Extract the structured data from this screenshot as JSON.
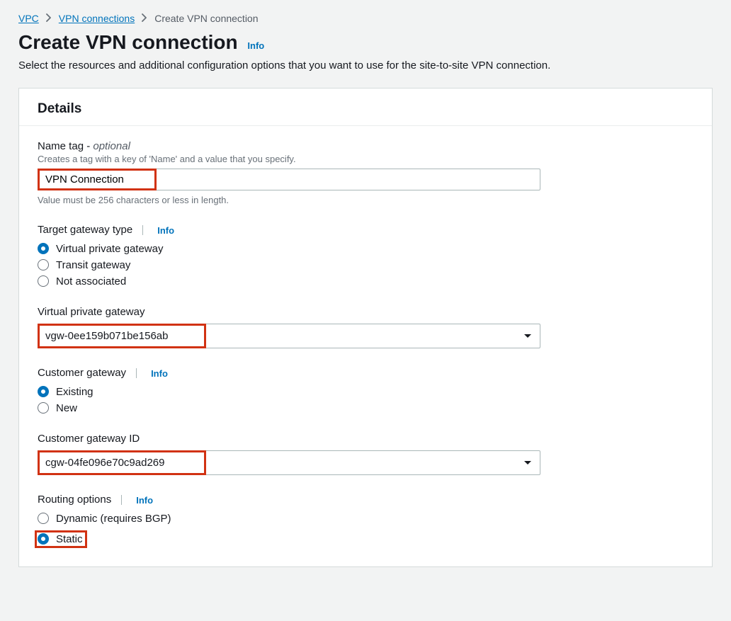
{
  "breadcrumb": {
    "vpc": "VPC",
    "vpn": "VPN connections",
    "current": "Create VPN connection"
  },
  "header": {
    "title": "Create VPN connection",
    "info": "Info",
    "desc": "Select the resources and additional configuration options that you want to use for the site-to-site VPN connection."
  },
  "panel": {
    "title": "Details"
  },
  "name": {
    "label": "Name tag -",
    "optional": "optional",
    "desc": "Creates a tag with a key of 'Name' and a value that you specify.",
    "value": "VPN Connection",
    "constraint": "Value must be 256 characters or less in length."
  },
  "target_gw": {
    "label": "Target gateway type",
    "info": "Info",
    "options": {
      "vpg": "Virtual private gateway",
      "tgw": "Transit gateway",
      "none": "Not associated"
    },
    "selected": "vpg"
  },
  "vpg": {
    "label": "Virtual private gateway",
    "value": "vgw-0ee159b071be156ab"
  },
  "cust_gw": {
    "label": "Customer gateway",
    "info": "Info",
    "options": {
      "existing": "Existing",
      "new": "New"
    },
    "selected": "existing"
  },
  "cgw_id": {
    "label": "Customer gateway ID",
    "value": "cgw-04fe096e70c9ad269"
  },
  "routing": {
    "label": "Routing options",
    "info": "Info",
    "options": {
      "dynamic": "Dynamic (requires BGP)",
      "static": "Static"
    },
    "selected": "static"
  }
}
